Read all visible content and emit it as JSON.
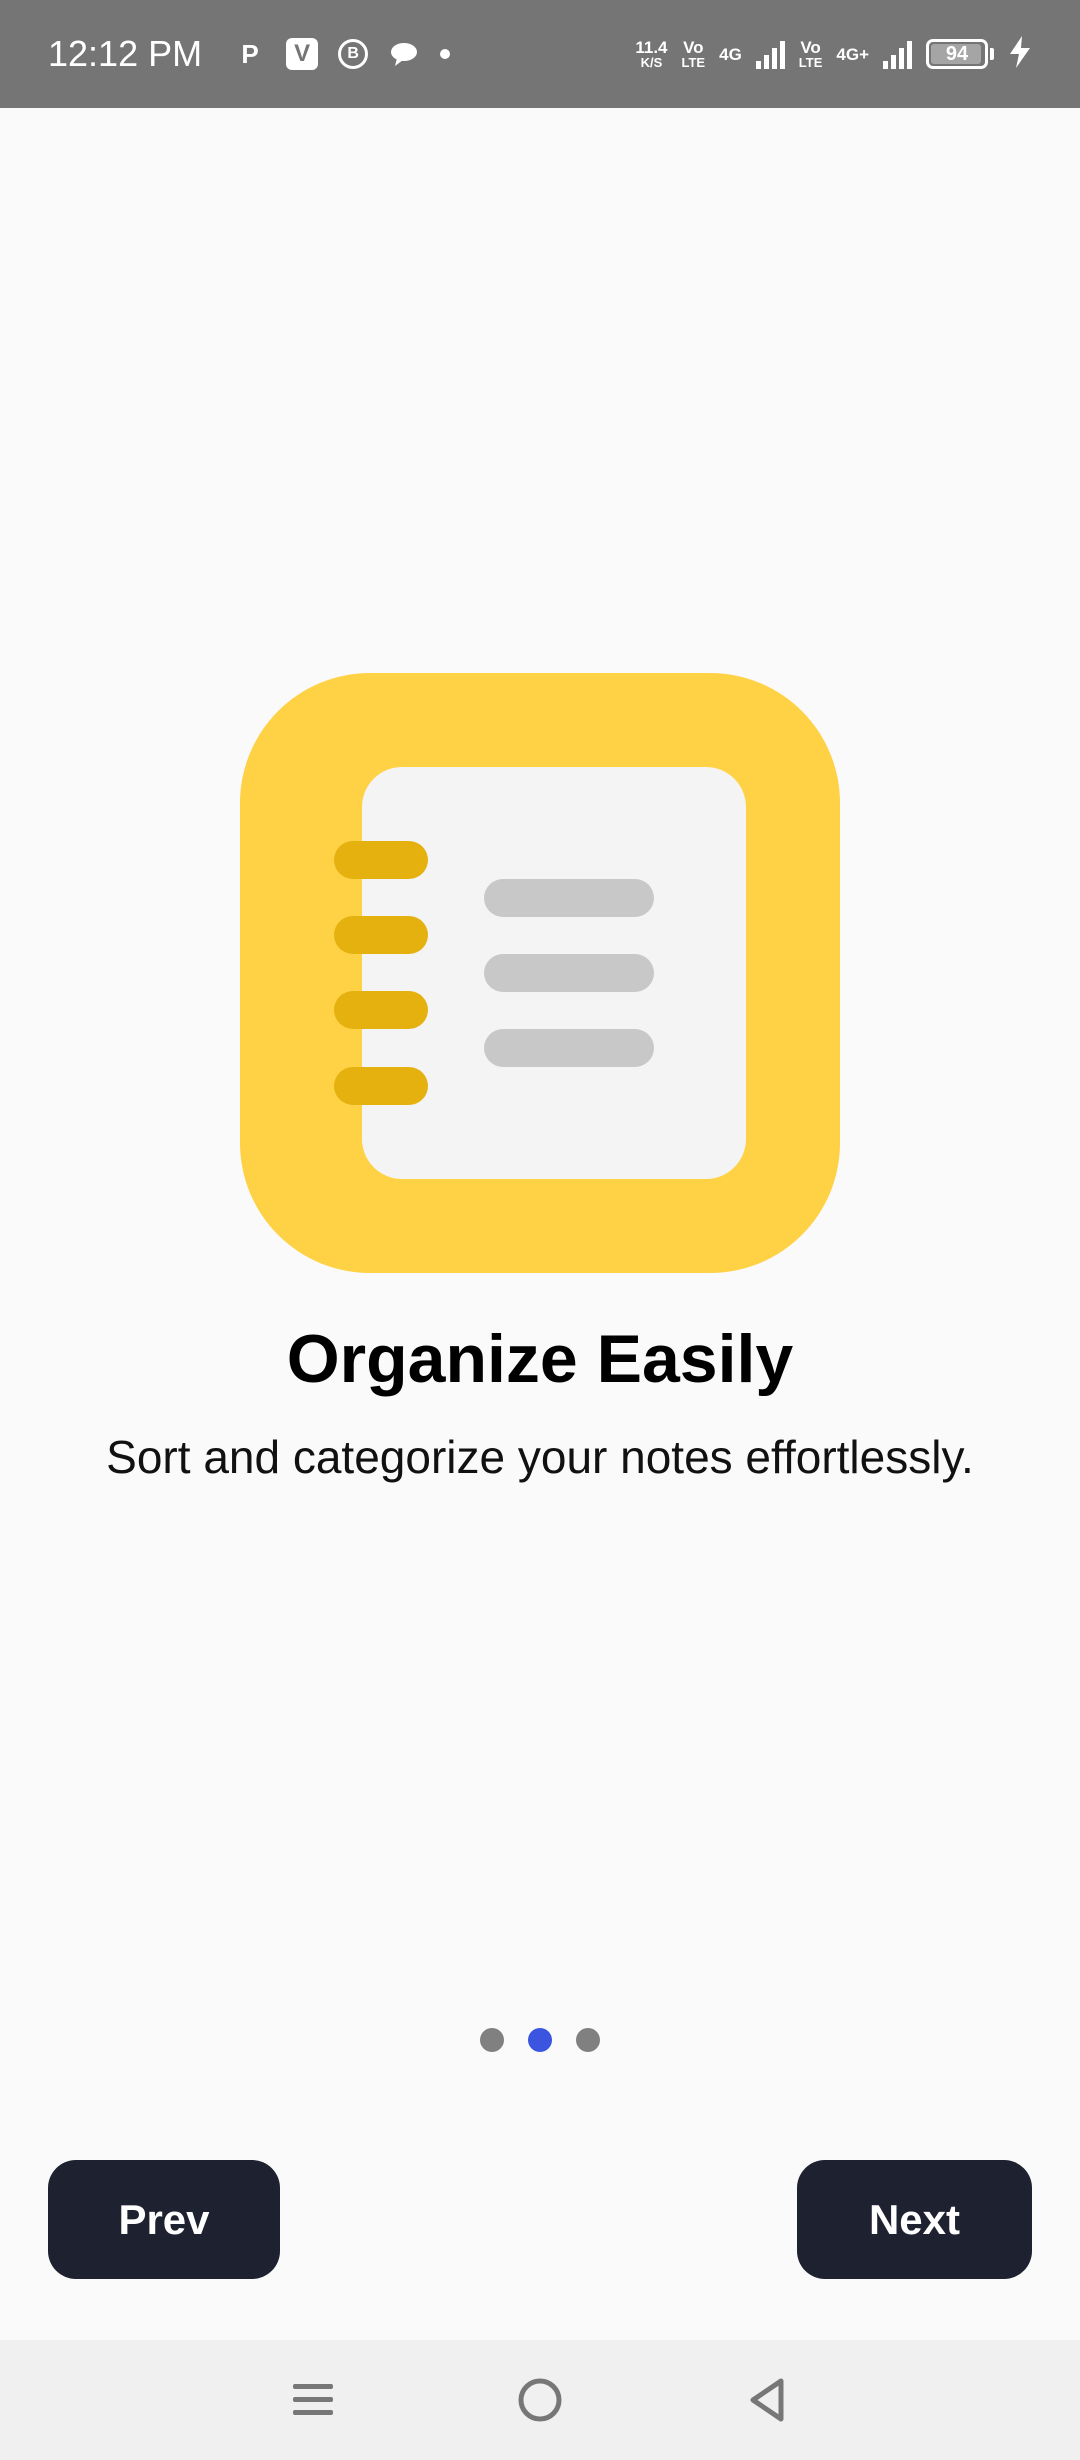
{
  "status_bar": {
    "time": "12:12 PM",
    "left_icons": [
      "p-app-icon",
      "v-app-icon",
      "b-app-icon",
      "chat-icon",
      "dot-icon"
    ],
    "network_speed_value": "11.4",
    "network_speed_unit": "K/S",
    "volte1_top": "Vo",
    "volte1_bottom": "LTE",
    "sim1_type": "4G",
    "volte2_top": "Vo",
    "volte2_bottom": "LTE",
    "sim2_type": "4G+",
    "battery_level": "94",
    "charging": true
  },
  "onboarding": {
    "title": "Organize Easily",
    "subtitle": "Sort and categorize your notes effortlessly.",
    "page_count": 3,
    "active_page": 1,
    "colors": {
      "icon_background": "#FFD145",
      "notebook_rings": "#E5B10F",
      "notebook_page": "#F4F4F4",
      "notebook_lines": "#C8C8C8",
      "active_dot": "#3B55E0",
      "inactive_dot": "#808080",
      "button_background": "#1E2130"
    }
  },
  "buttons": {
    "prev_label": "Prev",
    "next_label": "Next"
  },
  "nav_bar": {
    "items": [
      "menu-icon",
      "home-icon",
      "back-icon"
    ]
  }
}
